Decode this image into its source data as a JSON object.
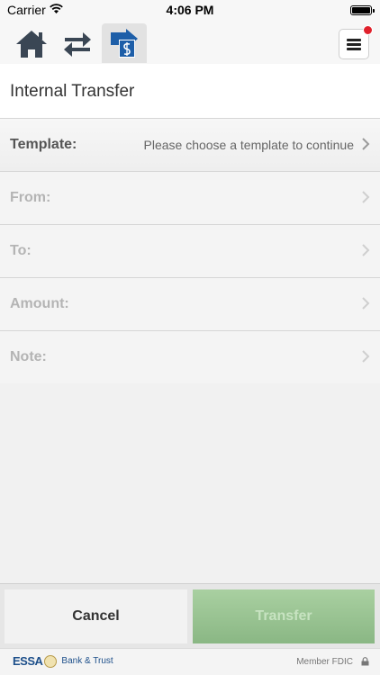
{
  "status_bar": {
    "carrier": "Carrier",
    "time": "4:06 PM"
  },
  "nav": {
    "icons": [
      "home-icon",
      "transfers-icon",
      "payments-icon",
      "menu-icon"
    ],
    "active": "payments-icon",
    "notification": true
  },
  "page": {
    "title": "Internal Transfer"
  },
  "form": {
    "template": {
      "label": "Template:",
      "value": "Please choose a template to continue"
    },
    "from": {
      "label": "From:"
    },
    "to": {
      "label": "To:"
    },
    "amount": {
      "label": "Amount:"
    },
    "note": {
      "label": "Note:"
    }
  },
  "buttons": {
    "cancel": "Cancel",
    "transfer": "Transfer"
  },
  "footer": {
    "brand_mark": "ESSA",
    "brand_name": "Bank & Trust",
    "member": "Member FDIC"
  },
  "colors": {
    "brand_blue": "#1d5ea8",
    "transfer_green": "#97c38f",
    "badge_red": "#e0212c"
  }
}
